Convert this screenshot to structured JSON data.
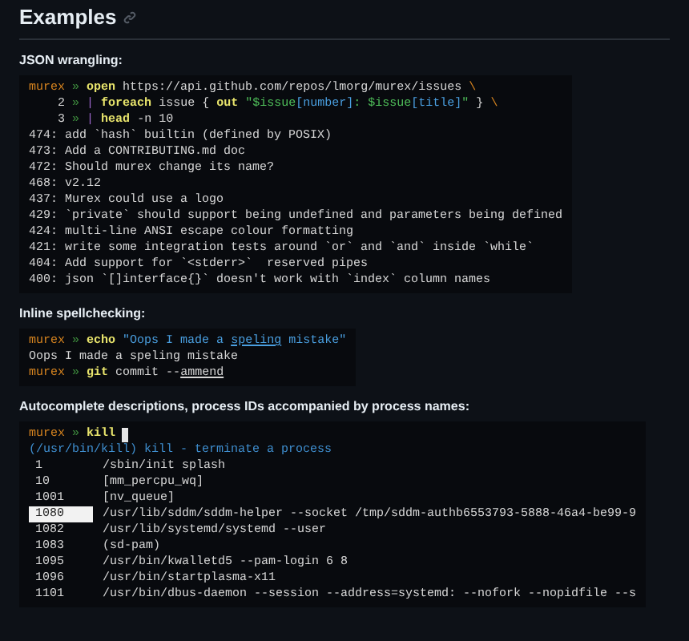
{
  "heading": {
    "title": "Examples"
  },
  "sections": [
    {
      "label": "JSON wrangling:",
      "kind": "code",
      "lines": [
        [
          {
            "kind": "prompt",
            "text": "murex"
          },
          {
            "kind": "sep",
            "text": " » "
          },
          {
            "kind": "cmd",
            "text": "open"
          },
          {
            "kind": "plain",
            "text": " https://api.github.com/repos/lmorg/murex/issues "
          },
          {
            "kind": "escape",
            "text": "\\"
          }
        ],
        [
          {
            "kind": "plain",
            "text": "    2 "
          },
          {
            "kind": "sep",
            "text": "» "
          },
          {
            "kind": "pipe",
            "text": "| "
          },
          {
            "kind": "cmd",
            "text": "foreach"
          },
          {
            "kind": "plain",
            "text": " issue { "
          },
          {
            "kind": "cmd",
            "text": "out"
          },
          {
            "kind": "var",
            "text": " \"$issue"
          },
          {
            "kind": "index",
            "text": "[number]"
          },
          {
            "kind": "var",
            "text": ": $issue"
          },
          {
            "kind": "index",
            "text": "[title]"
          },
          {
            "kind": "var",
            "text": "\""
          },
          {
            "kind": "plain",
            "text": " } "
          },
          {
            "kind": "escape",
            "text": "\\"
          }
        ],
        [
          {
            "kind": "plain",
            "text": "    3 "
          },
          {
            "kind": "sep",
            "text": "» "
          },
          {
            "kind": "pipe",
            "text": "| "
          },
          {
            "kind": "cmd",
            "text": "head"
          },
          {
            "kind": "plain",
            "text": " -n 10"
          }
        ],
        [
          {
            "kind": "plain",
            "text": "474: add `hash` builtin (defined by POSIX)"
          }
        ],
        [
          {
            "kind": "plain",
            "text": "473: Add a CONTRIBUTING.md doc"
          }
        ],
        [
          {
            "kind": "plain",
            "text": "472: Should murex change its name?"
          }
        ],
        [
          {
            "kind": "plain",
            "text": "468: v2.12"
          }
        ],
        [
          {
            "kind": "plain",
            "text": "437: Murex could use a logo"
          }
        ],
        [
          {
            "kind": "plain",
            "text": "429: `private` should support being undefined and parameters being defined"
          }
        ],
        [
          {
            "kind": "plain",
            "text": "424: multi-line ANSI escape colour formatting"
          }
        ],
        [
          {
            "kind": "plain",
            "text": "421: write some integration tests around `or` and `and` inside `while`"
          }
        ],
        [
          {
            "kind": "plain",
            "text": "404: Add support for `<stderr>`  reserved pipes"
          }
        ],
        [
          {
            "kind": "plain",
            "text": "400: json `[]interface{}` doesn't work with `index` column names"
          }
        ]
      ]
    },
    {
      "label": "Inline spellchecking:",
      "kind": "code",
      "lines": [
        [
          {
            "kind": "prompt",
            "text": "murex"
          },
          {
            "kind": "sep",
            "text": " » "
          },
          {
            "kind": "cmd",
            "text": "echo"
          },
          {
            "kind": "str",
            "text": " \"Oops I made a "
          },
          {
            "kind": "str_typo",
            "text": "speling"
          },
          {
            "kind": "str",
            "text": " mistake\""
          }
        ],
        [
          {
            "kind": "plain",
            "text": "Oops I made a speling mistake"
          }
        ],
        [
          {
            "kind": "prompt",
            "text": "murex"
          },
          {
            "kind": "sep",
            "text": " » "
          },
          {
            "kind": "cmd",
            "text": "git"
          },
          {
            "kind": "plain",
            "text": " commit --"
          },
          {
            "kind": "typo",
            "text": "ammend"
          }
        ]
      ]
    },
    {
      "label": "Autocomplete descriptions, process IDs accompanied by process names:",
      "kind": "autocomplete",
      "prompt": [
        {
          "kind": "prompt",
          "text": "murex"
        },
        {
          "kind": "sep",
          "text": " » "
        },
        {
          "kind": "cmd",
          "text": "kill"
        }
      ],
      "hint": "(/usr/bin/kill) kill - terminate a process",
      "rows": [
        {
          "pid": "1",
          "name": "/sbin/init splash",
          "selected": false
        },
        {
          "pid": "10",
          "name": "[mm_percpu_wq]",
          "selected": false
        },
        {
          "pid": "1001",
          "name": "[nv_queue]",
          "selected": false
        },
        {
          "pid": "1080",
          "name": "/usr/lib/sddm/sddm-helper --socket /tmp/sddm-authb6553793-5888-46a4-be99-9",
          "selected": true
        },
        {
          "pid": "1082",
          "name": "/usr/lib/systemd/systemd --user",
          "selected": false
        },
        {
          "pid": "1083",
          "name": "(sd-pam)",
          "selected": false
        },
        {
          "pid": "1095",
          "name": "/usr/bin/kwalletd5 --pam-login 6 8",
          "selected": false
        },
        {
          "pid": "1096",
          "name": "/usr/bin/startplasma-x11",
          "selected": false
        },
        {
          "pid": "1101",
          "name": "/usr/bin/dbus-daemon --session --address=systemd: --nofork --nopidfile --s",
          "selected": false
        }
      ]
    }
  ]
}
